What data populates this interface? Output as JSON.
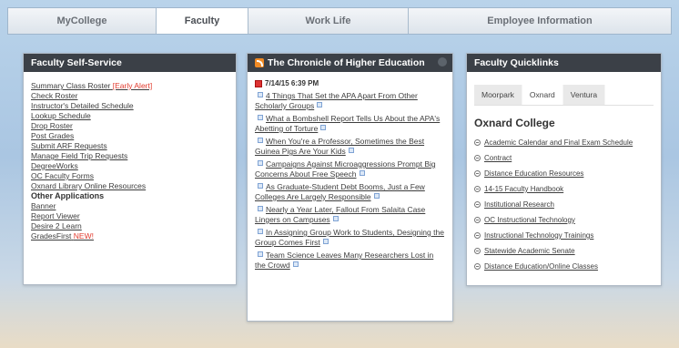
{
  "tabs": [
    {
      "label": "MyCollege"
    },
    {
      "label": "Faculty"
    },
    {
      "label": "Work Life"
    },
    {
      "label": "Employee Information"
    }
  ],
  "self_service": {
    "title": "Faculty Self-Service",
    "links": [
      {
        "label": "Summary Class Roster",
        "tag": "[Early Alert]"
      },
      {
        "label": "Check Roster"
      },
      {
        "label": "Instructor's Detailed Schedule"
      },
      {
        "label": "Lookup Schedule"
      },
      {
        "label": "Drop Roster"
      },
      {
        "label": "Post Grades"
      },
      {
        "label": "Submit ARF Requests"
      },
      {
        "label": "Manage Field Trip Requests"
      },
      {
        "label": "DegreeWorks"
      },
      {
        "label": "OC Faculty Forms"
      },
      {
        "label": "Oxnard Library Online Resources"
      }
    ],
    "other_apps_label": "Other Applications",
    "other_apps": [
      {
        "label": "Banner"
      },
      {
        "label": "Report Viewer"
      },
      {
        "label": "Desire 2 Learn"
      },
      {
        "label": "GradesFirst",
        "tag": "NEW!"
      }
    ]
  },
  "chronicle": {
    "title": "The Chronicle of Higher Education",
    "date": "7/14/15 6:39 PM",
    "articles": [
      "4 Things That Set the APA Apart From Other Scholarly Groups",
      "What a Bombshell Report Tells Us About the APA's Abetting of Torture",
      "When You're a Professor, Sometimes the Best Guinea Pigs Are Your Kids",
      "Campaigns Against Microaggressions Prompt Big Concerns About Free Speech",
      "As Graduate-Student Debt Booms, Just a Few Colleges Are Largely Responsible",
      "Nearly a Year Later, Fallout From Salaita Case Lingers on Campuses",
      "In Assigning Group Work to Students, Designing the Group Comes First",
      "Team Science Leaves Many Researchers Lost in the Crowd"
    ]
  },
  "quicklinks": {
    "title": "Faculty Quicklinks",
    "campus_tabs": [
      "Moorpark",
      "Oxnard",
      "Ventura"
    ],
    "college_title": "Oxnard College",
    "links": [
      "Academic Calendar and Final Exam Schedule",
      "Contract",
      "Distance Education Resources",
      "14-15 Faculty Handbook",
      "Institutional Research",
      "OC Instructional Technology",
      "Instructional Technology Trainings",
      "Statewide Academic Senate",
      "Distance Education/Online Classes"
    ]
  },
  "colors": {
    "panel_header_bg": "#3b4047",
    "alert_red": "#e23b2e",
    "rss_orange": "#f08a24"
  }
}
